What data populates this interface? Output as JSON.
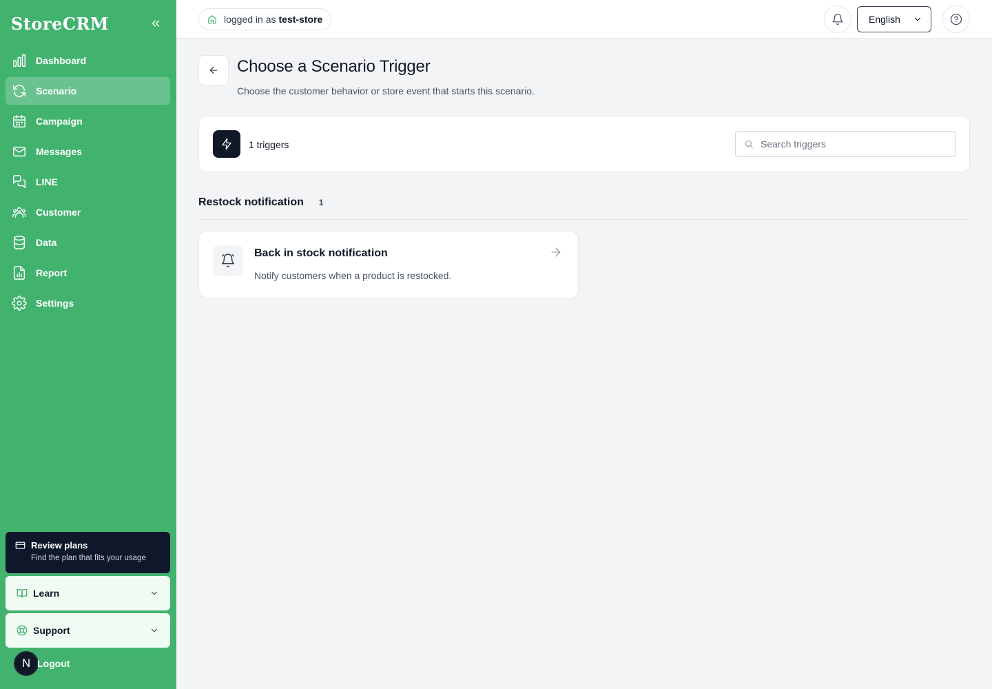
{
  "app": {
    "brand": "StoreCRM"
  },
  "sidebar": {
    "items": [
      {
        "label": "Dashboard",
        "icon": "bar-chart-icon",
        "active": false
      },
      {
        "label": "Scenario",
        "icon": "refresh-icon",
        "active": true
      },
      {
        "label": "Campaign",
        "icon": "calendar-icon",
        "active": false
      },
      {
        "label": "Messages",
        "icon": "mail-icon",
        "active": false
      },
      {
        "label": "LINE",
        "icon": "chat-bubbles-icon",
        "active": false
      },
      {
        "label": "Customer",
        "icon": "users-icon",
        "active": false
      },
      {
        "label": "Data",
        "icon": "database-icon",
        "active": false
      },
      {
        "label": "Report",
        "icon": "report-file-icon",
        "active": false
      },
      {
        "label": "Settings",
        "icon": "gear-icon",
        "active": false
      }
    ],
    "plans": {
      "title": "Review plans",
      "subtitle": "Find the plan that fits your usage"
    },
    "learn_label": "Learn",
    "support_label": "Support",
    "avatar_initial": "N",
    "logout_label": "Logout"
  },
  "topbar": {
    "logged_in_prefix": "logged in as",
    "store_name": "test-store",
    "language": "English"
  },
  "main": {
    "title": "Choose a Scenario Trigger",
    "subtitle": "Choose the customer behavior or store event that starts this scenario.",
    "trigger_count": "1 triggers",
    "search_placeholder": "Search triggers",
    "section": {
      "name": "Restock notification",
      "count": "1"
    },
    "triggers": [
      {
        "title": "Back in stock notification",
        "description": "Notify customers when a product is restocked.",
        "icon": "bell-icon"
      }
    ]
  },
  "colors": {
    "sidebar": "#41b36f",
    "dark": "#111827",
    "background": "#f3f4f6"
  }
}
